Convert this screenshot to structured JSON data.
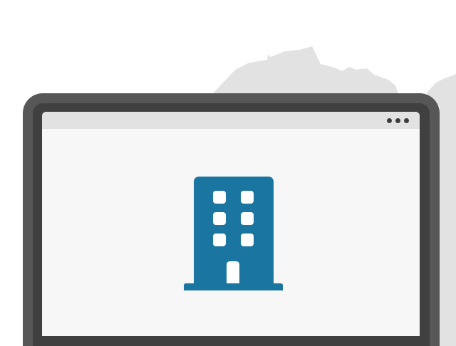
{
  "scene": {
    "icon": "building-icon",
    "window_controls_icon": "more-horizontal-icon"
  },
  "colors": {
    "background": "#ffffff",
    "map_silhouette": "#e2e2e2",
    "monitor_frame": "#575757",
    "monitor_bezel": "#404040",
    "browser_body": "#f7f7f7",
    "browser_titlebar": "#e2e2e2",
    "menu_dots": "#3c3c3c",
    "building_icon": "#1a75a0"
  }
}
